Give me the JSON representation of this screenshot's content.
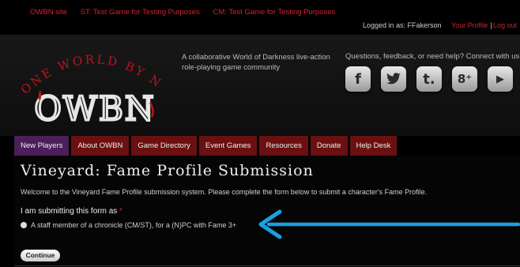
{
  "top_links": [
    "OWBN site",
    "ST: Test Game for Testing Purposes",
    "CM: Test Game for Testing Purposes"
  ],
  "login": {
    "prefix": "Logged in as: FFakerson",
    "profile": "Your Profile",
    "separator": "|",
    "logout": "Log out"
  },
  "logo": {
    "arc_text": "ONE WORLD BY NIGHT",
    "mark_text": "OWBN"
  },
  "tagline": "A collaborative World of Darkness live-action role-playing game community",
  "questions": "Questions, feedback, or need help? Connect with us:",
  "social": [
    {
      "icon": "facebook-icon",
      "glyph": "f"
    },
    {
      "icon": "twitter-icon",
      "glyph": "🐦"
    },
    {
      "icon": "tumblr-icon",
      "glyph": "t."
    },
    {
      "icon": "google-plus-icon",
      "glyph": "8⁺"
    },
    {
      "icon": "youtube-icon",
      "glyph": "▶"
    }
  ],
  "nav": [
    {
      "label": "New Players",
      "active": true
    },
    {
      "label": "About OWBN"
    },
    {
      "label": "Game Directory"
    },
    {
      "label": "Event Games"
    },
    {
      "label": "Resources"
    },
    {
      "label": "Donate"
    },
    {
      "label": "Help Desk"
    }
  ],
  "page": {
    "title": "Vineyard: Fame Profile Submission",
    "intro": "Welcome to the Vineyard Fame Profile submission system. Please complete the form below to submit a character's Fame Profile.",
    "form_label": "I am submitting this form as",
    "required_mark": "*",
    "option": "A staff member of a chronicle (CM/ST), for a (N)PC with Fame 3+",
    "continue": "Continue"
  },
  "colors": {
    "link_red": "#d2222a",
    "nav_red": "#6a1010",
    "nav_active": "#4b1f5a",
    "arrow": "#1aa0e0"
  }
}
